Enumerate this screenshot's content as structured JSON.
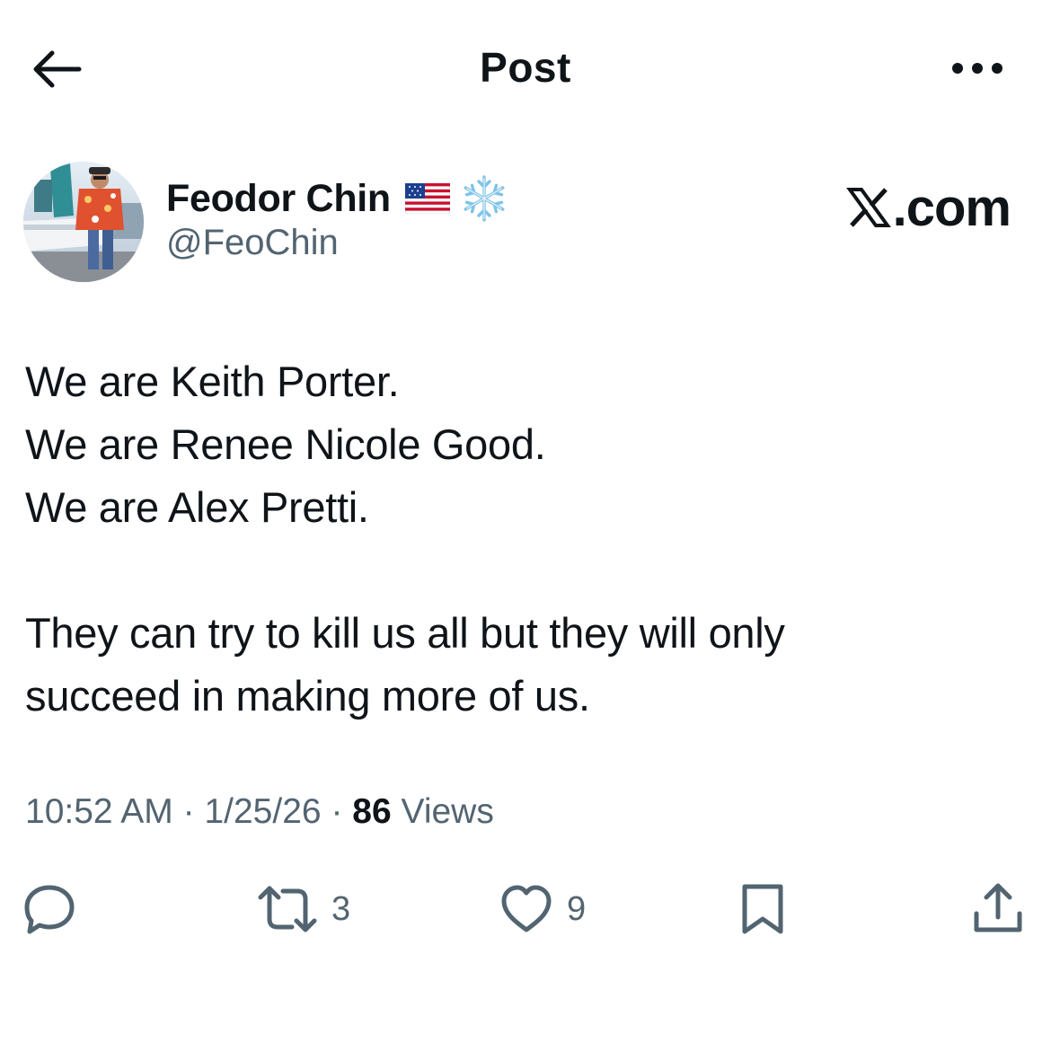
{
  "header": {
    "title": "Post",
    "back_icon": "arrow-left-icon",
    "more_icon": "more-horizontal-icon"
  },
  "author": {
    "display_name": "Feodor Chin",
    "handle": "@FeoChin",
    "emoji": [
      "flag-us-icon",
      "snowflake-icon"
    ]
  },
  "watermark": {
    "text": ".com",
    "logo_icon": "x-logo-icon"
  },
  "post": {
    "paragraph1": [
      "We are Keith Porter.",
      "We are Renee Nicole Good.",
      "We are Alex Pretti."
    ],
    "paragraph2": [
      "They can try to kill us all but they will only",
      "succeed in making more of us."
    ]
  },
  "meta": {
    "time": "10:52 AM",
    "separator": "·",
    "date": "1/25/26",
    "views_count": "86",
    "views_label": "Views"
  },
  "actions": {
    "reply": {
      "icon": "reply-icon",
      "count": ""
    },
    "repost": {
      "icon": "repost-icon",
      "count": "3"
    },
    "like": {
      "icon": "heart-icon",
      "count": "9"
    },
    "bookmark": {
      "icon": "bookmark-icon",
      "count": ""
    },
    "share": {
      "icon": "share-icon",
      "count": ""
    }
  },
  "colors": {
    "text_primary": "#0f1419",
    "text_secondary": "#536471",
    "background": "#ffffff"
  }
}
